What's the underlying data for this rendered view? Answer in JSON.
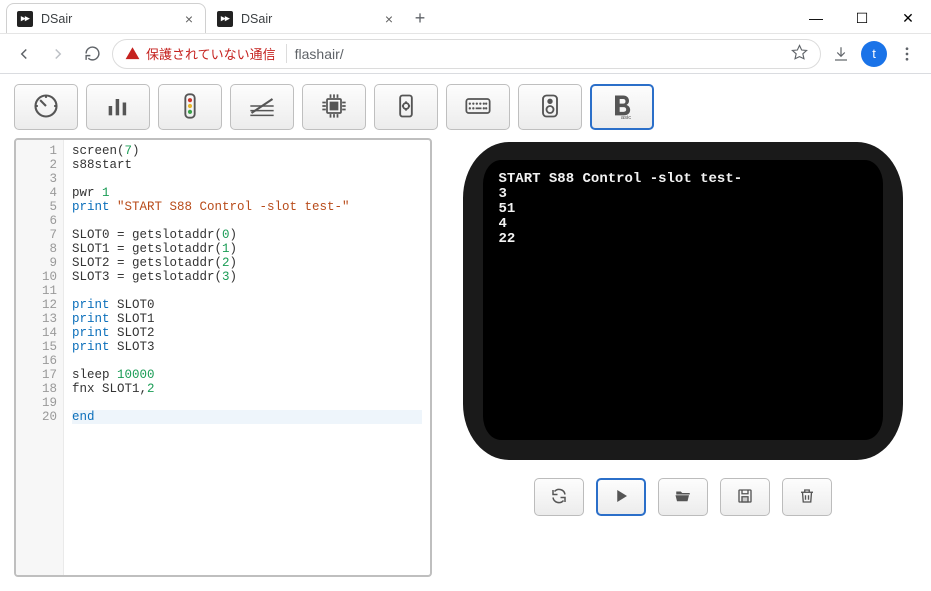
{
  "window": {
    "tabs": [
      {
        "title": "DSair",
        "active": true
      },
      {
        "title": "DSair",
        "active": false
      }
    ],
    "controls": {
      "min": "—",
      "max": "☐",
      "close": "✕"
    }
  },
  "addressbar": {
    "security_text": "保護されていない通信",
    "url_host": "flashair/",
    "avatar_initial": "t"
  },
  "toolbar": {
    "items": [
      {
        "name": "gauge"
      },
      {
        "name": "bar-chart"
      },
      {
        "name": "traffic-light"
      },
      {
        "name": "rails"
      },
      {
        "name": "cpu"
      },
      {
        "name": "device-settings"
      },
      {
        "name": "keyboard"
      },
      {
        "name": "speaker"
      },
      {
        "name": "basic"
      }
    ],
    "active_index": 8
  },
  "editor": {
    "current_line": 20,
    "lines": [
      [
        [
          "id",
          "screen("
        ],
        [
          "num",
          "7"
        ],
        [
          "id",
          ")"
        ]
      ],
      [
        [
          "id",
          "s88start"
        ]
      ],
      [],
      [
        [
          "id",
          "pwr "
        ],
        [
          "num",
          "1"
        ]
      ],
      [
        [
          "kw",
          "print "
        ],
        [
          "str",
          "\"START S88 Control -slot test-\""
        ]
      ],
      [],
      [
        [
          "id",
          "SLOT0 = getslotaddr("
        ],
        [
          "num",
          "0"
        ],
        [
          "id",
          ")"
        ]
      ],
      [
        [
          "id",
          "SLOT1 = getslotaddr("
        ],
        [
          "num",
          "1"
        ],
        [
          "id",
          ")"
        ]
      ],
      [
        [
          "id",
          "SLOT2 = getslotaddr("
        ],
        [
          "num",
          "2"
        ],
        [
          "id",
          ")"
        ]
      ],
      [
        [
          "id",
          "SLOT3 = getslotaddr("
        ],
        [
          "num",
          "3"
        ],
        [
          "id",
          ")"
        ]
      ],
      [],
      [
        [
          "kw",
          "print "
        ],
        [
          "id",
          "SLOT0"
        ]
      ],
      [
        [
          "kw",
          "print "
        ],
        [
          "id",
          "SLOT1"
        ]
      ],
      [
        [
          "kw",
          "print "
        ],
        [
          "id",
          "SLOT2"
        ]
      ],
      [
        [
          "kw",
          "print "
        ],
        [
          "id",
          "SLOT3"
        ]
      ],
      [],
      [
        [
          "id",
          "sleep "
        ],
        [
          "num",
          "10000"
        ]
      ],
      [
        [
          "id",
          "fnx SLOT1,"
        ],
        [
          "num",
          "2"
        ]
      ],
      [],
      [
        [
          "kw",
          "end"
        ]
      ]
    ]
  },
  "console": {
    "lines": [
      "START S88 Control -slot test-",
      "3",
      "51",
      "4",
      "22"
    ]
  },
  "runbar": {
    "buttons": [
      {
        "name": "reload"
      },
      {
        "name": "play"
      },
      {
        "name": "open"
      },
      {
        "name": "save"
      },
      {
        "name": "delete"
      }
    ],
    "primary_index": 1
  }
}
